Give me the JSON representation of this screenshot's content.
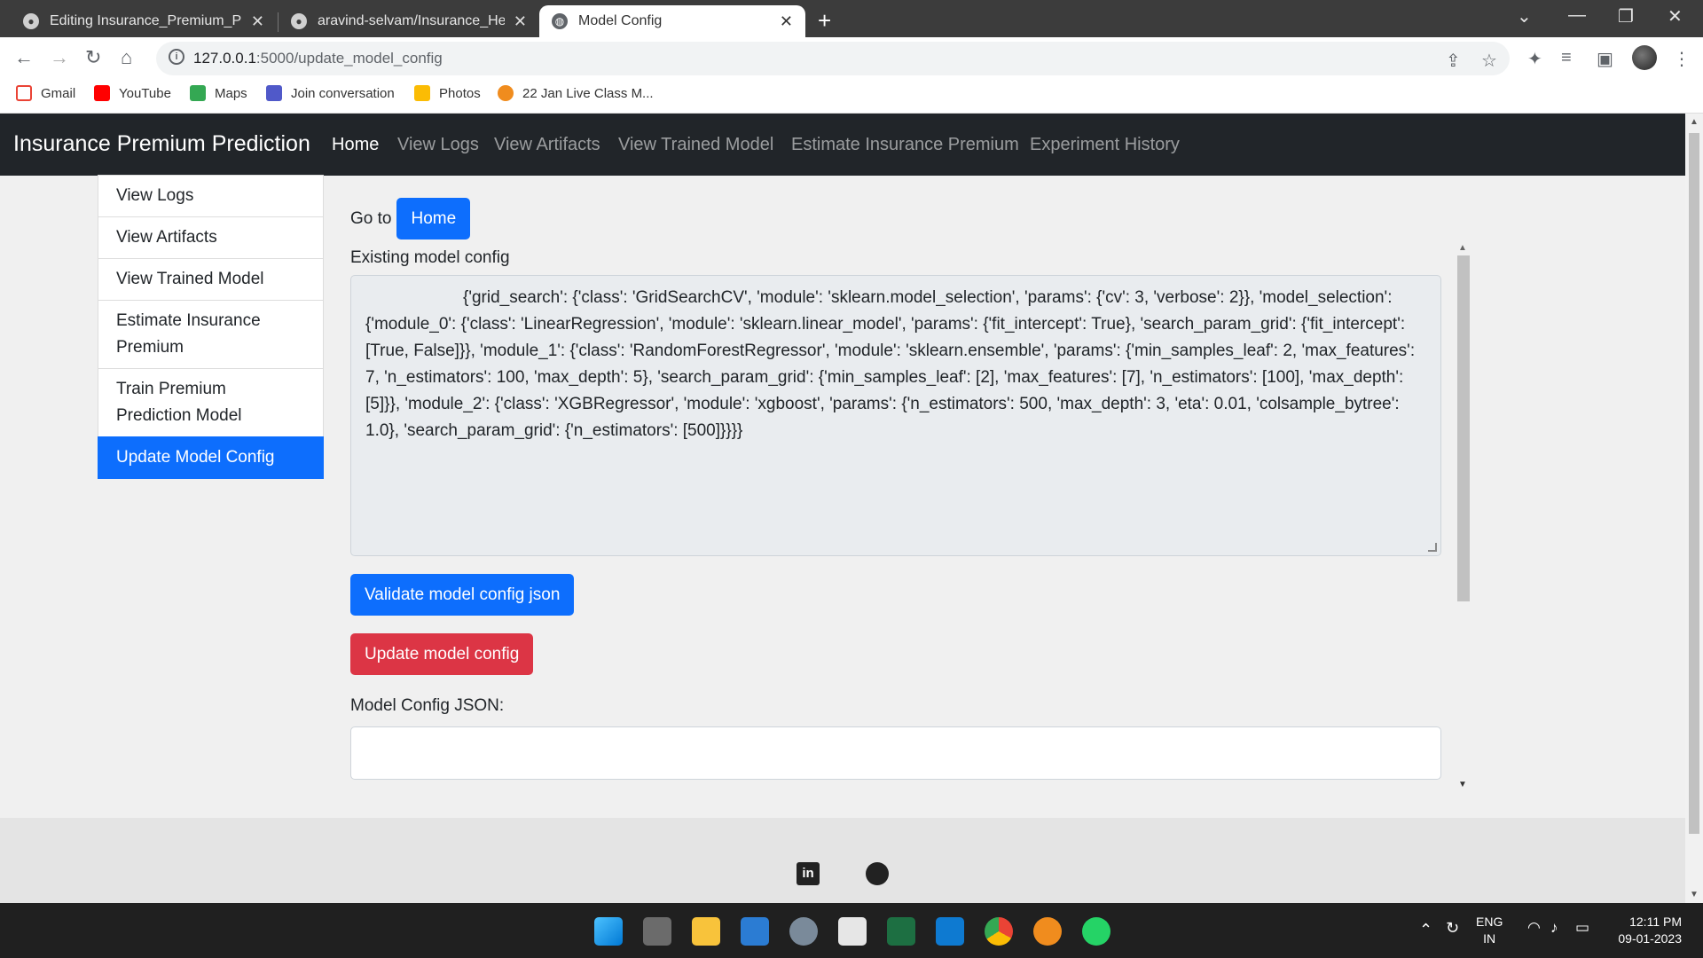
{
  "browser": {
    "tabs": [
      {
        "title": "Editing Insurance_Premium_Pred",
        "icon": "github-icon"
      },
      {
        "title": "aravind-selvam/Insurance_Health",
        "icon": "github-icon"
      },
      {
        "title": "Model Config",
        "icon": "globe-icon"
      }
    ],
    "url_host": "127.0.0.1",
    "url_path": ":5000/update_model_config",
    "bookmarks": [
      "Gmail",
      "YouTube",
      "Maps",
      "Join conversation",
      "Photos",
      "22 Jan Live Class M..."
    ]
  },
  "navbar": {
    "brand": "Insurance Premium Prediction",
    "links": [
      "Home",
      "View Logs",
      "View Artifacts",
      "View Trained Model",
      "Estimate Insurance Premium",
      "Experiment History"
    ],
    "active": "Home"
  },
  "sidebar": {
    "items": [
      {
        "label": "View Logs"
      },
      {
        "label": "View Artifacts"
      },
      {
        "label": "View Trained Model"
      },
      {
        "label": "Estimate Insurance Premium"
      },
      {
        "label": "Train Premium Prediction Model"
      },
      {
        "label": "Update Model Config"
      }
    ],
    "active": "Update Model Config"
  },
  "main": {
    "goto_label": "Go to",
    "home_button": "Home",
    "existing_label": "Existing model config",
    "existing_config": "{'grid_search': {'class': 'GridSearchCV', 'module': 'sklearn.model_selection', 'params': {'cv': 3, 'verbose': 2}}, 'model_selection': {'module_0': {'class': 'LinearRegression', 'module': 'sklearn.linear_model', 'params': {'fit_intercept': True}, 'search_param_grid': {'fit_intercept': [True, False]}}, 'module_1': {'class': 'RandomForestRegressor', 'module': 'sklearn.ensemble', 'params': {'min_samples_leaf': 2, 'max_features': 7, 'n_estimators': 100, 'max_depth': 5}, 'search_param_grid': {'min_samples_leaf': [2], 'max_features': [7], 'n_estimators': [100], 'max_depth': [5]}}, 'module_2': {'class': 'XGBRegressor', 'module': 'xgboost', 'params': {'n_estimators': 500, 'max_depth': 3, 'eta': 0.01, 'colsample_bytree': 1.0}, 'search_param_grid': {'n_estimators': [500]}}}}",
    "validate_button": "Validate model config json",
    "update_button": "Update model config",
    "json_label": "Model Config JSON:",
    "json_value": ""
  },
  "taskbar": {
    "lang_top": "ENG",
    "lang_bottom": "IN",
    "time": "12:11 PM",
    "date": "09-01-2023"
  },
  "colors": {
    "primary": "#0d6efd",
    "danger": "#dc3545",
    "navbar": "#212529"
  }
}
